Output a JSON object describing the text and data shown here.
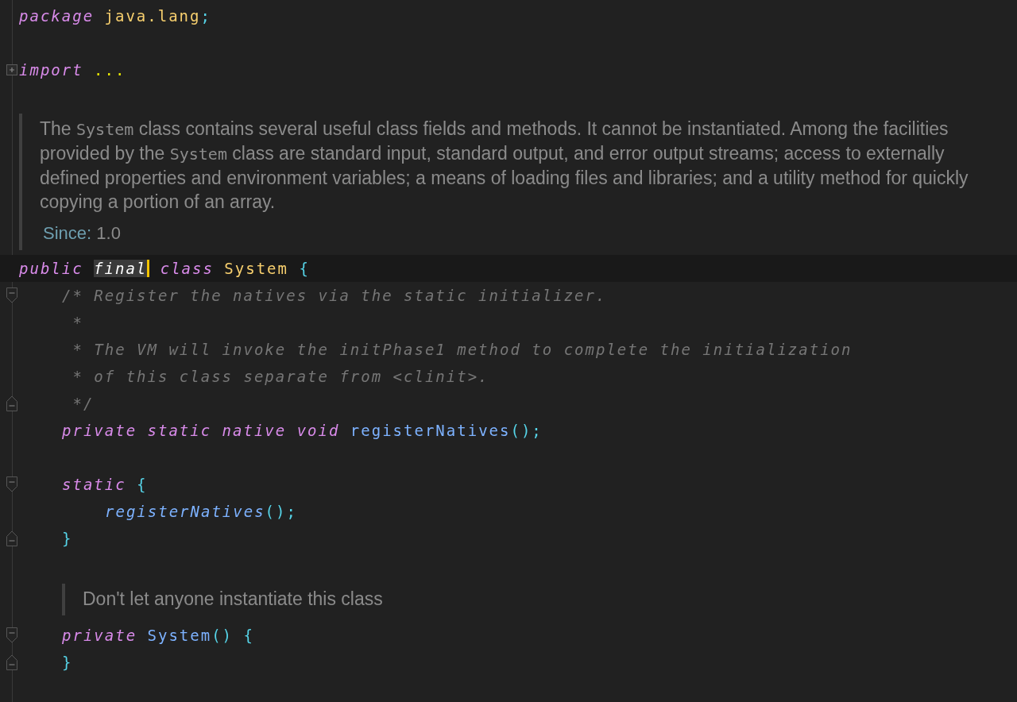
{
  "lines": [
    {
      "kind": "code",
      "current": false,
      "tokens": [
        {
          "kind": "keyword",
          "text": "package"
        },
        {
          "kind": "type",
          "text": " java.lang"
        },
        {
          "kind": "punct",
          "text": ";"
        }
      ]
    },
    {
      "kind": "blank"
    },
    {
      "kind": "code",
      "current": false,
      "gutter_icon": {
        "kind": "collapsed"
      },
      "tokens": [
        {
          "kind": "keyword",
          "text": "import"
        },
        {
          "kind": "ellipsis",
          "text": " ..."
        }
      ]
    },
    {
      "kind": "doc",
      "paragraph": [
        {
          "kind": "prose",
          "text": "The "
        },
        {
          "kind": "code",
          "text": "System"
        },
        {
          "kind": "prose",
          "text": " class contains several useful class fields and methods. It cannot be instantiated. Among the facilities provided by the "
        },
        {
          "kind": "code",
          "text": "System"
        },
        {
          "kind": "prose",
          "text": " class are standard input, standard output, and error output streams; access to externally defined properties and environment variables; a means of loading files and libraries; and a utility method for quickly copying a portion of an array."
        }
      ],
      "since": {
        "label": "Since:",
        "value": "1.0"
      }
    },
    {
      "kind": "code",
      "current": true,
      "tokens": [
        {
          "kind": "keyword",
          "text": "public "
        },
        {
          "kind": "keyword",
          "text": "final",
          "caret": true
        },
        {
          "kind": "keyword",
          "text": " class"
        },
        {
          "kind": "type",
          "text": " System"
        },
        {
          "kind": "punct",
          "text": " {"
        }
      ],
      "children": [
        {
          "kind": "code",
          "current": false,
          "gutter_icon": {
            "kind": "start"
          },
          "tokens": [
            {
              "kind": "comment",
              "text": "/* Register the natives via the static initializer."
            }
          ]
        },
        {
          "kind": "code",
          "current": false,
          "tokens": [
            {
              "kind": "comment",
              "text": " *"
            }
          ]
        },
        {
          "kind": "code",
          "current": false,
          "tokens": [
            {
              "kind": "comment",
              "text": " * The VM will invoke the initPhase1 method to complete the initialization"
            }
          ]
        },
        {
          "kind": "code",
          "current": false,
          "tokens": [
            {
              "kind": "comment",
              "text": " * of this class separate from <clinit>."
            }
          ]
        },
        {
          "kind": "code",
          "current": false,
          "gutter_icon": {
            "kind": "end"
          },
          "tokens": [
            {
              "kind": "comment",
              "text": " */"
            }
          ]
        },
        {
          "kind": "code",
          "current": false,
          "tokens": [
            {
              "kind": "keyword",
              "text": "private static native void"
            },
            {
              "kind": "method",
              "text": " registerNatives"
            },
            {
              "kind": "punct",
              "text": "();"
            }
          ]
        },
        {
          "kind": "blank"
        },
        {
          "kind": "code",
          "current": false,
          "gutter_icon": {
            "kind": "start"
          },
          "tokens": [
            {
              "kind": "keyword",
              "text": "static"
            },
            {
              "kind": "punct",
              "text": " {"
            }
          ],
          "children": [
            {
              "kind": "code",
              "current": false,
              "tokens": [
                {
                  "kind": "static-call",
                  "text": "registerNatives"
                },
                {
                  "kind": "punct",
                  "text": "();"
                }
              ]
            }
          ]
        },
        {
          "kind": "code",
          "current": false,
          "gutter_icon": {
            "kind": "end"
          },
          "tokens": [
            {
              "kind": "punct",
              "text": "}"
            }
          ]
        },
        {
          "kind": "blank"
        },
        {
          "kind": "doc",
          "paragraph": [
            {
              "kind": "prose",
              "text": "Don't let anyone instantiate this class"
            }
          ]
        },
        {
          "kind": "code",
          "current": false,
          "gutter_icon": {
            "kind": "start"
          },
          "tokens": [
            {
              "kind": "keyword",
              "text": "private"
            },
            {
              "kind": "method",
              "text": " System"
            },
            {
              "kind": "punct",
              "text": "() {"
            }
          ]
        },
        {
          "kind": "code",
          "current": false,
          "gutter_icon": {
            "kind": "end"
          },
          "tokens": [
            {
              "kind": "punct",
              "text": "}"
            }
          ]
        }
      ]
    }
  ]
}
